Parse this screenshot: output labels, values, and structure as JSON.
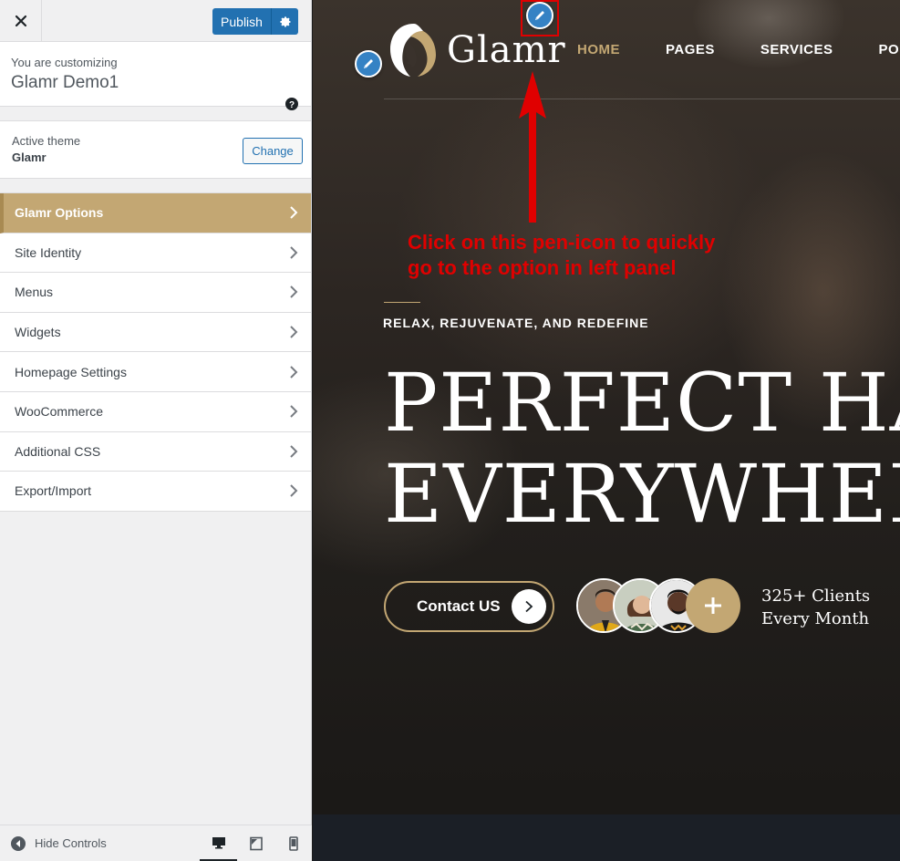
{
  "sidebar": {
    "close_label": "×",
    "publish_label": "Publish",
    "customizing_label": "You are customizing",
    "site_name": "Glamr Demo1",
    "active_theme_label": "Active theme",
    "theme_name": "Glamr",
    "change_label": "Change",
    "menu": [
      {
        "label": "Glamr Options",
        "active": true
      },
      {
        "label": "Site Identity",
        "active": false
      },
      {
        "label": "Menus",
        "active": false
      },
      {
        "label": "Widgets",
        "active": false
      },
      {
        "label": "Homepage Settings",
        "active": false
      },
      {
        "label": "WooCommerce",
        "active": false
      },
      {
        "label": "Additional CSS",
        "active": false
      },
      {
        "label": "Export/Import",
        "active": false
      }
    ],
    "hide_controls_label": "Hide Controls",
    "devices": [
      "desktop-icon",
      "tablet-icon",
      "mobile-icon"
    ]
  },
  "preview": {
    "logo_text": "Glamr",
    "nav": [
      "HOME",
      "PAGES",
      "SERVICES",
      "PORTF"
    ],
    "annotation_line1": "Click on this pen-icon to quickly",
    "annotation_line2": "go to the option in left panel",
    "tagline": "RELAX, REJUVENATE, AND REDEFINE",
    "headline_line1": "PERFECT HA",
    "headline_line2": "EVERYWHER",
    "contact_label": "Contact US",
    "clients_line1": "325+ Clients",
    "clients_line2": "Every Month"
  },
  "colors": {
    "accent_gold": "#c3a773",
    "wp_blue": "#2271b1",
    "annotation_red": "#e00000"
  }
}
